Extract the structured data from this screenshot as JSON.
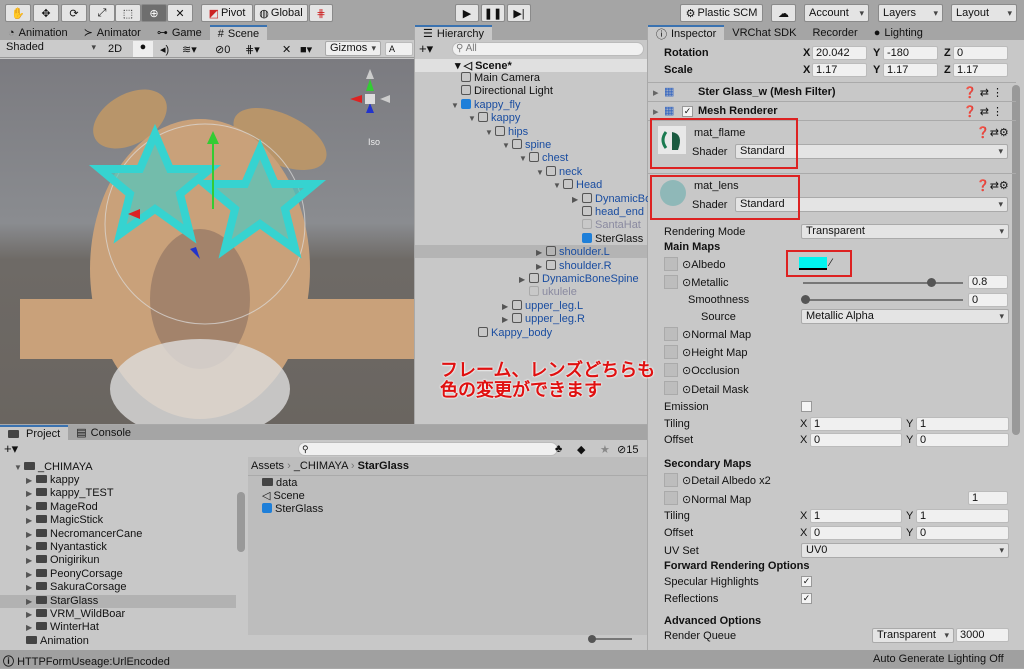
{
  "toolbar": {
    "tools": [
      "hand-tool",
      "move-tool",
      "rotate-tool",
      "scale-tool",
      "rect-tool",
      "transform-tool",
      "custom-tool"
    ],
    "pivot": "Pivot",
    "global": "Global",
    "plastic": "Plastic SCM",
    "account": "Account",
    "layers": "Layers",
    "layout": "Layout"
  },
  "scene": {
    "tabs": [
      "Animation",
      "Animator",
      "Game",
      "Scene"
    ],
    "shading": "Shaded",
    "mode2d": "2D",
    "hidden_count": "0",
    "gizmos": "Gizmos",
    "search_placeholder": "A",
    "iso": "Iso",
    "annotation_line1": "フレーム、レンズどちらも",
    "annotation_line2": "色の変更ができます"
  },
  "hierarchy": {
    "title": "Hierarchy",
    "search_placeholder": "All",
    "scene": "Scene*",
    "items": [
      {
        "label": "Main Camera",
        "depth": 0,
        "style": "normal"
      },
      {
        "label": "Directional Light",
        "depth": 0,
        "style": "normal"
      },
      {
        "label": "kappy_fly",
        "depth": 0,
        "style": "prefab",
        "expanded": true
      },
      {
        "label": "kappy",
        "depth": 1,
        "style": "blue",
        "expanded": true
      },
      {
        "label": "hips",
        "depth": 2,
        "style": "blue",
        "expanded": true
      },
      {
        "label": "spine",
        "depth": 3,
        "style": "blue",
        "expanded": true
      },
      {
        "label": "chest",
        "depth": 4,
        "style": "blue",
        "expanded": true
      },
      {
        "label": "neck",
        "depth": 5,
        "style": "blue",
        "expanded": true
      },
      {
        "label": "Head",
        "depth": 6,
        "style": "blue",
        "expanded": true
      },
      {
        "label": "DynamicBoneHea",
        "depth": 7,
        "style": "blue",
        "collapsed": true
      },
      {
        "label": "head_end",
        "depth": 7,
        "style": "blue"
      },
      {
        "label": "SantaHat",
        "depth": 7,
        "style": "grey"
      },
      {
        "label": "SterGlass",
        "depth": 7,
        "style": "selected"
      },
      {
        "label": "shoulder.L",
        "depth": 5,
        "style": "blue",
        "collapsed": true
      },
      {
        "label": "shoulder.R",
        "depth": 5,
        "style": "blue",
        "collapsed": true
      },
      {
        "label": "DynamicBoneSpine",
        "depth": 4,
        "style": "blue",
        "collapsed": true
      },
      {
        "label": "ukulele",
        "depth": 4,
        "style": "grey"
      },
      {
        "label": "upper_leg.L",
        "depth": 3,
        "style": "blue",
        "collapsed": true
      },
      {
        "label": "upper_leg.R",
        "depth": 3,
        "style": "blue",
        "collapsed": true
      },
      {
        "label": "Kappy_body",
        "depth": 1,
        "style": "blue"
      }
    ]
  },
  "inspector": {
    "tabs": [
      "Inspector",
      "VRChat SDK",
      "Recorder",
      "Lighting"
    ],
    "rotation": {
      "label": "Rotation",
      "x": "20.042",
      "y": "-180",
      "z": "0"
    },
    "scale": {
      "label": "Scale",
      "x": "1.17",
      "y": "1.17",
      "z": "1.17"
    },
    "mesh_filter": "Ster Glass_w (Mesh Filter)",
    "mesh_renderer": "Mesh Renderer",
    "mat1": {
      "name": "mat_flame",
      "shader_label": "Shader",
      "shader": "Standard"
    },
    "mat2": {
      "name": "mat_lens",
      "shader_label": "Shader",
      "shader": "Standard"
    },
    "rendering_mode_label": "Rendering Mode",
    "rendering_mode": "Transparent",
    "main_maps": "Main Maps",
    "albedo": "Albedo",
    "albedo_color": "#00f5f0",
    "metallic": "Metallic",
    "metallic_value": "0.8",
    "metallic_fraction": 0.8,
    "smoothness": "Smoothness",
    "smoothness_value": "0",
    "source_label": "Source",
    "source": "Metallic Alpha",
    "normal_map": "Normal Map",
    "height_map": "Height Map",
    "occlusion": "Occlusion",
    "detail_mask": "Detail Mask",
    "emission": "Emission",
    "tiling": "Tiling",
    "offset": "Offset",
    "tiling_x": "1",
    "tiling_y": "1",
    "offset_x": "0",
    "offset_y": "0",
    "secondary_maps": "Secondary Maps",
    "detail_albedo": "Detail Albedo x2",
    "normal_map2": "Normal Map",
    "normal_scale": "1",
    "tiling2_x": "1",
    "tiling2_y": "1",
    "offset2_x": "0",
    "offset2_y": "0",
    "uv_set_label": "UV Set",
    "uv_set": "UV0",
    "forward": "Forward Rendering Options",
    "specular": "Specular Highlights",
    "reflections": "Reflections",
    "advanced": "Advanced Options",
    "render_queue_label": "Render Queue",
    "render_queue_mode": "Transparent",
    "render_queue": "3000"
  },
  "project": {
    "tabs": [
      "Project",
      "Console"
    ],
    "hidden_count": "15",
    "breadcrumb": [
      "Assets",
      "_CHIMAYA",
      "StarGlass"
    ],
    "root_folder": "_CHIMAYA",
    "folders": [
      "kappy",
      "kappy_TEST",
      "MageRod",
      "MagicStick",
      "NecromancerCane",
      "Nyantastick",
      "Onigirikun",
      "PeonyCorsage",
      "SakuraCorsage",
      "StarGlass",
      "VRM_WildBoar",
      "WinterHat"
    ],
    "extra_folder": "Animation",
    "assets": [
      {
        "label": "data",
        "icon": "folder-icon"
      },
      {
        "label": "Scene",
        "icon": "unity-scene-icon"
      },
      {
        "label": "SterGlass",
        "icon": "prefab-icon"
      }
    ]
  },
  "status": {
    "left": "HTTPFormUseage:UrlEncoded",
    "right": "Auto Generate Lighting Off"
  }
}
